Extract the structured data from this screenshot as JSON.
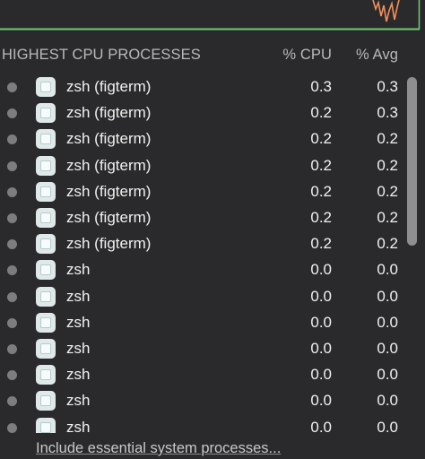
{
  "header": {
    "title": "HIGHEST CPU PROCESSES",
    "cpu_label": "% CPU",
    "avg_label": "% Avg"
  },
  "colors": {
    "background": "#2a2a2c",
    "graph_line_green": "#6fcf6f",
    "graph_spike_orange": "#f0905a",
    "status_dot": "#7d7d80"
  },
  "processes": [
    {
      "name": "zsh (figterm)",
      "cpu": "0.3",
      "avg": "0.3",
      "icon": "terminal-app-icon"
    },
    {
      "name": "zsh (figterm)",
      "cpu": "0.2",
      "avg": "0.3",
      "icon": "terminal-app-icon"
    },
    {
      "name": "zsh (figterm)",
      "cpu": "0.2",
      "avg": "0.2",
      "icon": "terminal-app-icon"
    },
    {
      "name": "zsh (figterm)",
      "cpu": "0.2",
      "avg": "0.2",
      "icon": "terminal-app-icon"
    },
    {
      "name": "zsh (figterm)",
      "cpu": "0.2",
      "avg": "0.2",
      "icon": "terminal-app-icon"
    },
    {
      "name": "zsh (figterm)",
      "cpu": "0.2",
      "avg": "0.2",
      "icon": "terminal-app-icon"
    },
    {
      "name": "zsh (figterm)",
      "cpu": "0.2",
      "avg": "0.2",
      "icon": "terminal-app-icon"
    },
    {
      "name": "zsh",
      "cpu": "0.0",
      "avg": "0.0",
      "icon": "terminal-app-icon"
    },
    {
      "name": "zsh",
      "cpu": "0.0",
      "avg": "0.0",
      "icon": "terminal-app-icon"
    },
    {
      "name": "zsh",
      "cpu": "0.0",
      "avg": "0.0",
      "icon": "terminal-app-icon"
    },
    {
      "name": "zsh",
      "cpu": "0.0",
      "avg": "0.0",
      "icon": "terminal-app-icon"
    },
    {
      "name": "zsh",
      "cpu": "0.0",
      "avg": "0.0",
      "icon": "terminal-app-icon"
    },
    {
      "name": "zsh",
      "cpu": "0.0",
      "avg": "0.0",
      "icon": "terminal-app-icon"
    },
    {
      "name": "zsh",
      "cpu": "0.0",
      "avg": "0.0",
      "icon": "terminal-app-icon"
    }
  ],
  "footer": {
    "link_label": "Include essential system processes..."
  }
}
